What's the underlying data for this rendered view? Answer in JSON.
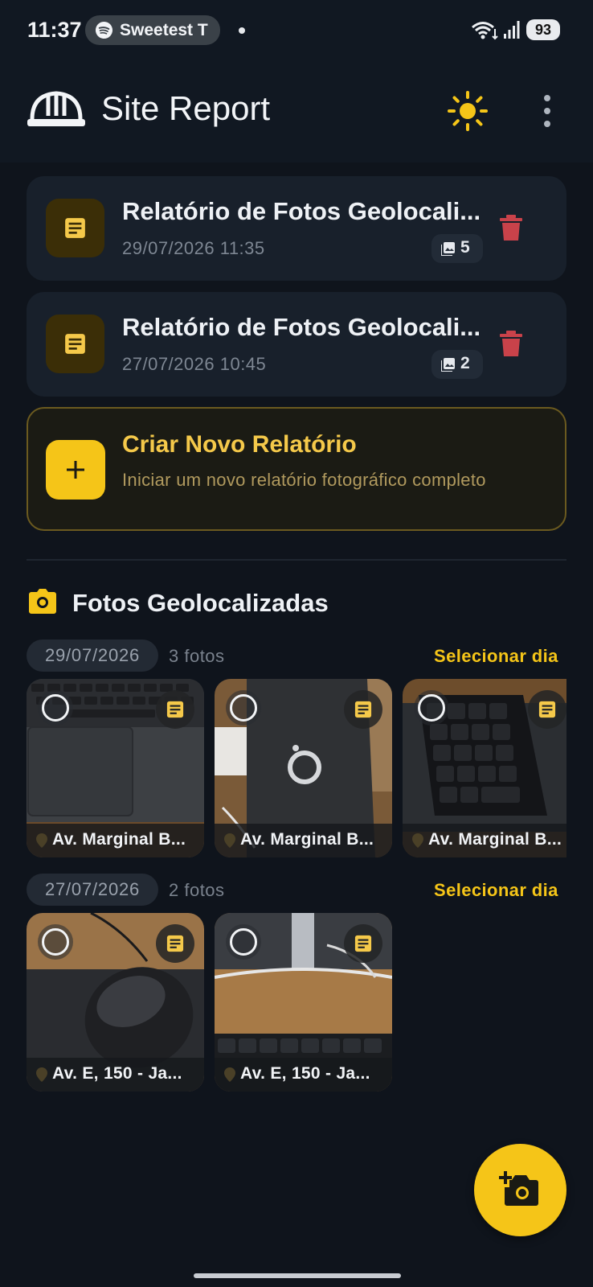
{
  "status_bar": {
    "time": "11:37",
    "media_app_icon": "spotify-icon",
    "media_title": "Sweetest T",
    "battery": "93"
  },
  "app_bar": {
    "title": "Site Report",
    "logo_icon": "hard-hat-icon",
    "theme_icon": "sun-icon",
    "menu_icon": "more-vert-icon"
  },
  "reports": [
    {
      "title": "Relatório de Fotos Geolocali...",
      "date": "29/07/2026 11:35",
      "photo_count": "5"
    },
    {
      "title": "Relatório de Fotos Geolocali...",
      "date": "27/07/2026 10:45",
      "photo_count": "2"
    }
  ],
  "create_report": {
    "title": "Criar Novo Relatório",
    "subtitle": "Iniciar um novo relatório fotográfico completo"
  },
  "photos_section": {
    "title": "Fotos Geolocalizadas",
    "groups": [
      {
        "date": "29/07/2026",
        "count": "3 fotos",
        "select_label": "Selecionar dia",
        "photos": [
          {
            "caption": "Av. Marginal B...",
            "subject": "laptop keyboard"
          },
          {
            "caption": "Av. Marginal B...",
            "subject": "phone on desk"
          },
          {
            "caption": "Av. Marginal B...",
            "subject": "keypad"
          }
        ]
      },
      {
        "date": "27/07/2026",
        "count": "2 fotos",
        "select_label": "Selecionar dia",
        "photos": [
          {
            "caption": "Av. E, 150 - Ja...",
            "subject": "mouse"
          },
          {
            "caption": "Av. E, 150 - Ja...",
            "subject": "keyboard"
          }
        ]
      }
    ]
  },
  "fab": {
    "icon": "add-photo-camera-icon"
  },
  "colors": {
    "accent": "#f5c518",
    "background": "#0f141c",
    "card": "#18202b",
    "delete": "#c9424a"
  }
}
